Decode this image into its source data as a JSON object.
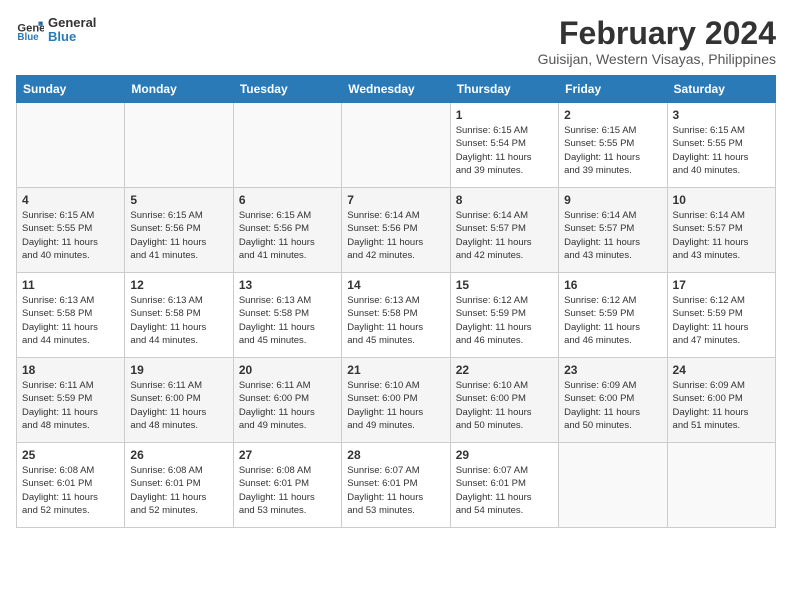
{
  "header": {
    "logo_line1": "General",
    "logo_line2": "Blue",
    "title": "February 2024",
    "subtitle": "Guisijan, Western Visayas, Philippines"
  },
  "days_of_week": [
    "Sunday",
    "Monday",
    "Tuesday",
    "Wednesday",
    "Thursday",
    "Friday",
    "Saturday"
  ],
  "weeks": [
    [
      {
        "day": "",
        "info": ""
      },
      {
        "day": "",
        "info": ""
      },
      {
        "day": "",
        "info": ""
      },
      {
        "day": "",
        "info": ""
      },
      {
        "day": "1",
        "info": "Sunrise: 6:15 AM\nSunset: 5:54 PM\nDaylight: 11 hours\nand 39 minutes."
      },
      {
        "day": "2",
        "info": "Sunrise: 6:15 AM\nSunset: 5:55 PM\nDaylight: 11 hours\nand 39 minutes."
      },
      {
        "day": "3",
        "info": "Sunrise: 6:15 AM\nSunset: 5:55 PM\nDaylight: 11 hours\nand 40 minutes."
      }
    ],
    [
      {
        "day": "4",
        "info": "Sunrise: 6:15 AM\nSunset: 5:55 PM\nDaylight: 11 hours\nand 40 minutes."
      },
      {
        "day": "5",
        "info": "Sunrise: 6:15 AM\nSunset: 5:56 PM\nDaylight: 11 hours\nand 41 minutes."
      },
      {
        "day": "6",
        "info": "Sunrise: 6:15 AM\nSunset: 5:56 PM\nDaylight: 11 hours\nand 41 minutes."
      },
      {
        "day": "7",
        "info": "Sunrise: 6:14 AM\nSunset: 5:56 PM\nDaylight: 11 hours\nand 42 minutes."
      },
      {
        "day": "8",
        "info": "Sunrise: 6:14 AM\nSunset: 5:57 PM\nDaylight: 11 hours\nand 42 minutes."
      },
      {
        "day": "9",
        "info": "Sunrise: 6:14 AM\nSunset: 5:57 PM\nDaylight: 11 hours\nand 43 minutes."
      },
      {
        "day": "10",
        "info": "Sunrise: 6:14 AM\nSunset: 5:57 PM\nDaylight: 11 hours\nand 43 minutes."
      }
    ],
    [
      {
        "day": "11",
        "info": "Sunrise: 6:13 AM\nSunset: 5:58 PM\nDaylight: 11 hours\nand 44 minutes."
      },
      {
        "day": "12",
        "info": "Sunrise: 6:13 AM\nSunset: 5:58 PM\nDaylight: 11 hours\nand 44 minutes."
      },
      {
        "day": "13",
        "info": "Sunrise: 6:13 AM\nSunset: 5:58 PM\nDaylight: 11 hours\nand 45 minutes."
      },
      {
        "day": "14",
        "info": "Sunrise: 6:13 AM\nSunset: 5:58 PM\nDaylight: 11 hours\nand 45 minutes."
      },
      {
        "day": "15",
        "info": "Sunrise: 6:12 AM\nSunset: 5:59 PM\nDaylight: 11 hours\nand 46 minutes."
      },
      {
        "day": "16",
        "info": "Sunrise: 6:12 AM\nSunset: 5:59 PM\nDaylight: 11 hours\nand 46 minutes."
      },
      {
        "day": "17",
        "info": "Sunrise: 6:12 AM\nSunset: 5:59 PM\nDaylight: 11 hours\nand 47 minutes."
      }
    ],
    [
      {
        "day": "18",
        "info": "Sunrise: 6:11 AM\nSunset: 5:59 PM\nDaylight: 11 hours\nand 48 minutes."
      },
      {
        "day": "19",
        "info": "Sunrise: 6:11 AM\nSunset: 6:00 PM\nDaylight: 11 hours\nand 48 minutes."
      },
      {
        "day": "20",
        "info": "Sunrise: 6:11 AM\nSunset: 6:00 PM\nDaylight: 11 hours\nand 49 minutes."
      },
      {
        "day": "21",
        "info": "Sunrise: 6:10 AM\nSunset: 6:00 PM\nDaylight: 11 hours\nand 49 minutes."
      },
      {
        "day": "22",
        "info": "Sunrise: 6:10 AM\nSunset: 6:00 PM\nDaylight: 11 hours\nand 50 minutes."
      },
      {
        "day": "23",
        "info": "Sunrise: 6:09 AM\nSunset: 6:00 PM\nDaylight: 11 hours\nand 50 minutes."
      },
      {
        "day": "24",
        "info": "Sunrise: 6:09 AM\nSunset: 6:00 PM\nDaylight: 11 hours\nand 51 minutes."
      }
    ],
    [
      {
        "day": "25",
        "info": "Sunrise: 6:08 AM\nSunset: 6:01 PM\nDaylight: 11 hours\nand 52 minutes."
      },
      {
        "day": "26",
        "info": "Sunrise: 6:08 AM\nSunset: 6:01 PM\nDaylight: 11 hours\nand 52 minutes."
      },
      {
        "day": "27",
        "info": "Sunrise: 6:08 AM\nSunset: 6:01 PM\nDaylight: 11 hours\nand 53 minutes."
      },
      {
        "day": "28",
        "info": "Sunrise: 6:07 AM\nSunset: 6:01 PM\nDaylight: 11 hours\nand 53 minutes."
      },
      {
        "day": "29",
        "info": "Sunrise: 6:07 AM\nSunset: 6:01 PM\nDaylight: 11 hours\nand 54 minutes."
      },
      {
        "day": "",
        "info": ""
      },
      {
        "day": "",
        "info": ""
      }
    ]
  ]
}
